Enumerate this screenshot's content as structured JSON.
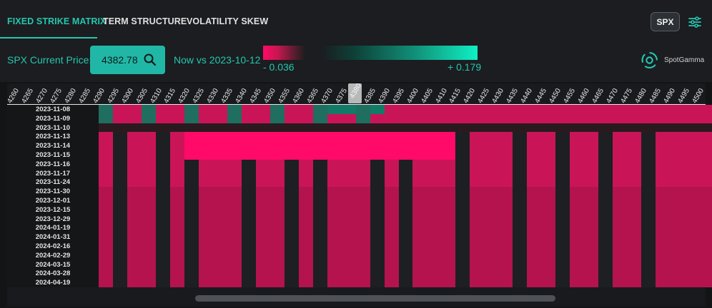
{
  "tabs": [
    {
      "label": "FIXED STRIKE MATRIX",
      "active": true
    },
    {
      "label": "TERM STRUCTURE",
      "active": false
    },
    {
      "label": "VOLATILITY SKEW",
      "active": false
    }
  ],
  "symbol_button": "SPX",
  "icons": {
    "settings": "sliders-icon",
    "search": "search-icon",
    "logo": "spotgamma-logo-icon"
  },
  "price": {
    "label": "SPX Current Price:",
    "value": "4382.78"
  },
  "compare": {
    "label": "Now vs 2023-10-12"
  },
  "legend": {
    "min_label": "- 0.036",
    "max_label": "+ 0.179",
    "neg_color": "#ff0a68",
    "pos_color": "#10f0c4"
  },
  "brand": "SpotGamma",
  "colors": {
    "accent": "#26c6b0",
    "negative": "#ff0a68",
    "positive": "#10f0c4",
    "empty": "#1e1f22"
  },
  "matrix": {
    "current_strike": "4380",
    "strikes": [
      "4260",
      "4265",
      "4270",
      "4275",
      "4280",
      "4285",
      "4290",
      "4295",
      "4300",
      "4305",
      "4310",
      "4315",
      "4320",
      "4325",
      "4330",
      "4335",
      "4340",
      "4345",
      "4350",
      "4355",
      "4360",
      "4365",
      "4370",
      "4375",
      "4380",
      "4385",
      "4390",
      "4395",
      "4400",
      "4405",
      "4410",
      "4415",
      "4420",
      "4425",
      "4430",
      "4435",
      "4440",
      "4445",
      "4450",
      "4455",
      "4460",
      "4465",
      "4470",
      "4475",
      "4480",
      "4485",
      "4490",
      "4495",
      "4500"
    ],
    "expirations": [
      "2023-11-08",
      "2023-11-09",
      "2023-11-10",
      "2023-11-13",
      "2023-11-14",
      "2023-11-15",
      "2023-11-16",
      "2023-11-17",
      "2023-11-24",
      "2023-11-30",
      "2023-12-01",
      "2023-12-15",
      "2023-12-29",
      "2024-01-19",
      "2024-01-31",
      "2024-02-16",
      "2024-02-29",
      "2024-03-15",
      "2024-03-28",
      "2024-04-19"
    ]
  }
}
